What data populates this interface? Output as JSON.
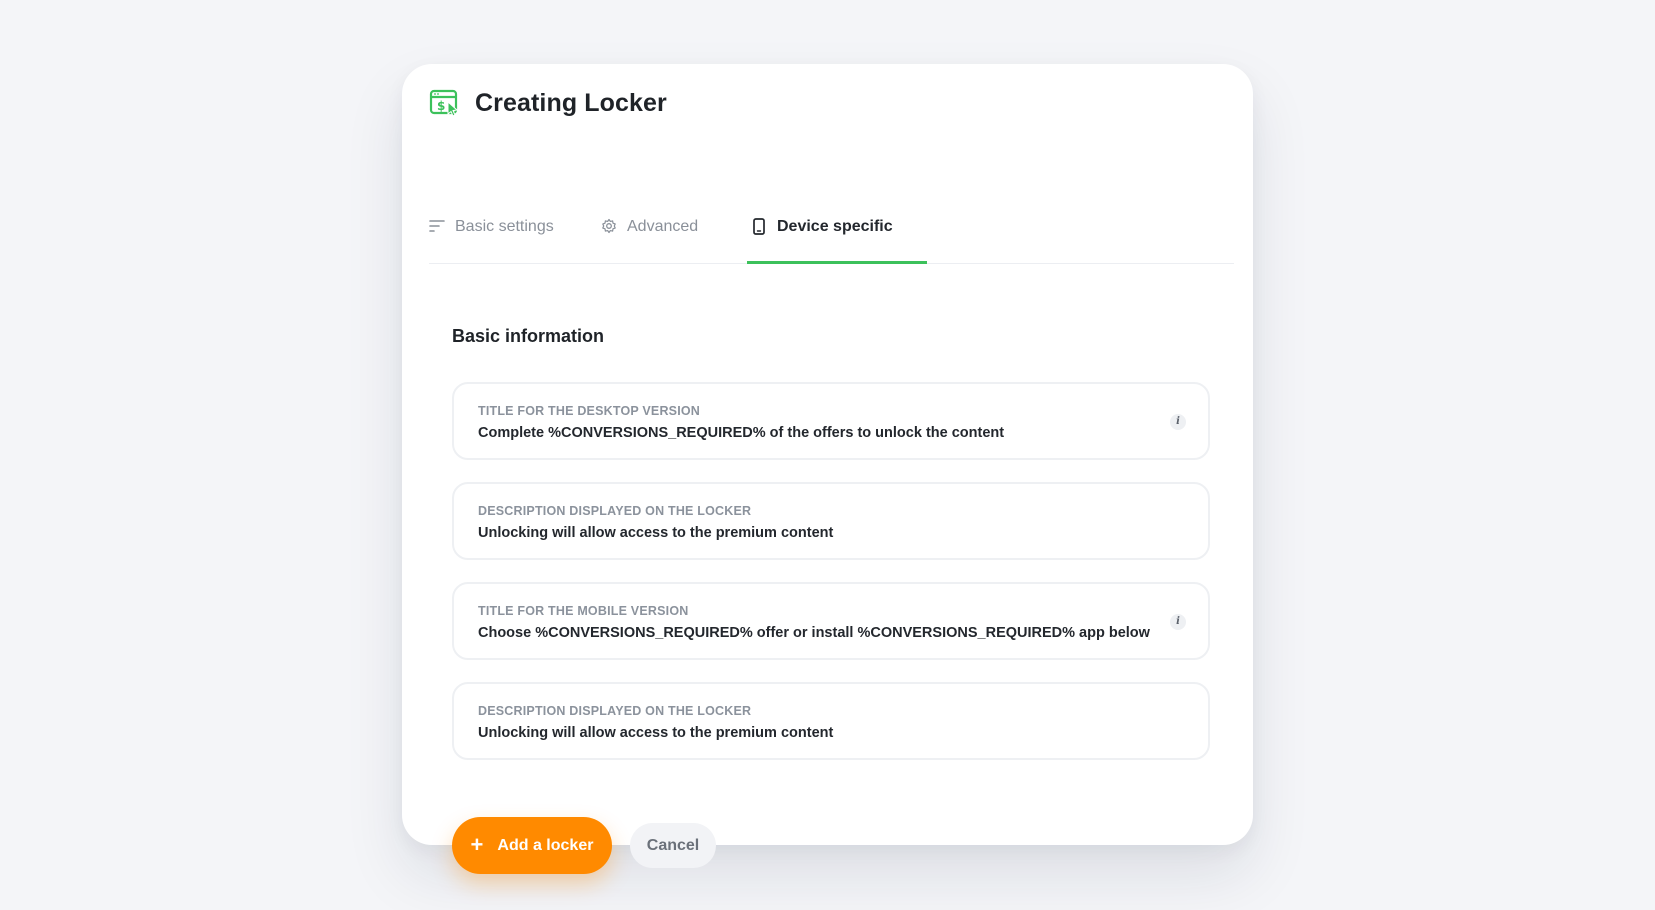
{
  "modal": {
    "title": "Creating Locker",
    "logo_icon": "browser-dollar-cursor-icon"
  },
  "tabs": [
    {
      "label": "Basic settings",
      "icon": "sort-lines-icon",
      "active": false
    },
    {
      "label": "Advanced",
      "icon": "gear-icon",
      "active": false
    },
    {
      "label": "Device specific",
      "icon": "mobile-phone-icon",
      "active": true
    }
  ],
  "section": {
    "title": "Basic information"
  },
  "fields": [
    {
      "label": "TITLE FOR THE DESKTOP VERSION",
      "value": "Complete %CONVERSIONS_REQUIRED% of the offers to unlock the content",
      "info": "i"
    },
    {
      "label": "DESCRIPTION DISPLAYED ON THE LOCKER",
      "value": "Unlocking will allow access to the premium content"
    },
    {
      "label": "TITLE FOR THE MOBILE VERSION",
      "value": "Choose %CONVERSIONS_REQUIRED% offer or install %CONVERSIONS_REQUIRED% app below",
      "info": "i"
    },
    {
      "label": "DESCRIPTION DISPLAYED ON THE LOCKER",
      "value": "Unlocking will allow access to the premium content"
    }
  ],
  "actions": {
    "add_label": "Add a locker",
    "add_icon": "+",
    "cancel_label": "Cancel"
  },
  "colors": {
    "accent_green": "#3cc15b",
    "primary_orange": "#ff8a00",
    "background": "#f4f5f8"
  }
}
